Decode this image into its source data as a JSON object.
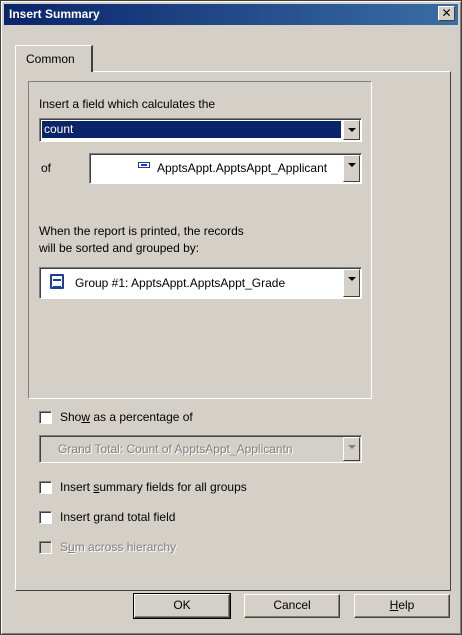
{
  "window": {
    "title": "Insert Summary",
    "close_glyph": "✕"
  },
  "tabs": [
    {
      "label": "Common"
    }
  ],
  "calc_group": {
    "insert_label": "Insert a field which calculates the",
    "calc_select_value": "count",
    "of_label": "of",
    "field_select_value": "ApptsAppt.ApptsAppt_Applicant",
    "sorted_line1": "When the report is printed, the records",
    "sorted_line2": "will be sorted and grouped by:",
    "group_select_value": "Group #1: ApptsAppt.ApptsAppt_Grade"
  },
  "options": {
    "show_pct": {
      "pre": "Sho",
      "accel": "w",
      "post": " as a percentage of",
      "checked": false
    },
    "pct_select_value": "Grand Total: Count of ApptsAppt_Applicantn",
    "insert_summary_all": {
      "pre": "Insert ",
      "accel": "s",
      "post": "ummary fields for all groups",
      "checked": false
    },
    "insert_grand_total": {
      "pre": "Insert ",
      "accel": "g",
      "post": "rand total field",
      "checked": false
    },
    "sum_hierarchy": {
      "pre": "S",
      "accel": "u",
      "post": "m across hierarchy",
      "checked": false,
      "enabled": false
    }
  },
  "buttons": {
    "ok": "OK",
    "cancel": "Cancel",
    "help_accel": "H",
    "help_rest": "elp"
  },
  "colors": {
    "titlebar_start": "#0a246a",
    "titlebar_end": "#3a6ea5",
    "face": "#d4d0c8",
    "selection": "#0a246a"
  }
}
